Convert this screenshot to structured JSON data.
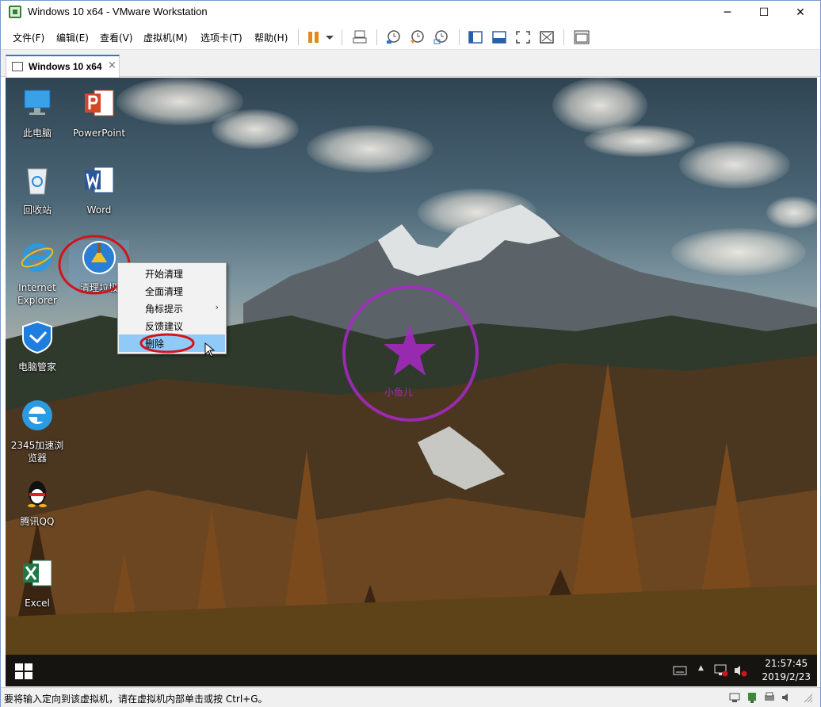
{
  "window": {
    "title": "Windows 10 x64 - VMware Workstation",
    "minimize": "─",
    "maximize": "☐",
    "close": "✕"
  },
  "menu": {
    "items": [
      "文件(F)",
      "编辑(E)",
      "查看(V)",
      "虚拟机(M)",
      "选项卡(T)",
      "帮助(H)"
    ]
  },
  "tab": {
    "label": "Windows 10 x64",
    "close": "×"
  },
  "desktop": {
    "icons": [
      {
        "label": "此电脑",
        "icon": "this-pc-icon"
      },
      {
        "label": "PowerPoint",
        "icon": "powerpoint-icon"
      },
      {
        "label": "回收站",
        "icon": "recycle-bin-icon"
      },
      {
        "label": "Word",
        "icon": "word-icon"
      },
      {
        "label": "Internet Explorer",
        "icon": "internet-explorer-icon"
      },
      {
        "label": "清理垃圾",
        "icon": "cleaner-broom-icon"
      },
      {
        "label": "电脑管家",
        "icon": "pc-manager-shield-icon"
      },
      {
        "label": "2345加速浏览器",
        "icon": "browser-2345-icon"
      },
      {
        "label": "腾讯QQ",
        "icon": "qq-penguin-icon"
      },
      {
        "label": "Excel",
        "icon": "excel-icon"
      }
    ]
  },
  "context_menu": {
    "items": [
      "开始清理",
      "全面清理",
      "角标提示",
      "反馈建议",
      "删除"
    ],
    "submenu_arrow": "›",
    "highlighted": "删除"
  },
  "taskbar": {
    "time": "21:57:45",
    "date": "2019/2/23",
    "tray_up_arrow": "▲"
  },
  "statusbar": {
    "text": "要将输入定向到该虚拟机，请在虚拟机内部单击或按 Ctrl+G。"
  },
  "watermark": {
    "stamp_text": "小鱼儿"
  },
  "colors": {
    "tab_accent": "#2a78c7",
    "menu_highlight": "#91c9f7",
    "annotation_red": "#d0141c",
    "stamp_purple": "#aa28c8"
  }
}
